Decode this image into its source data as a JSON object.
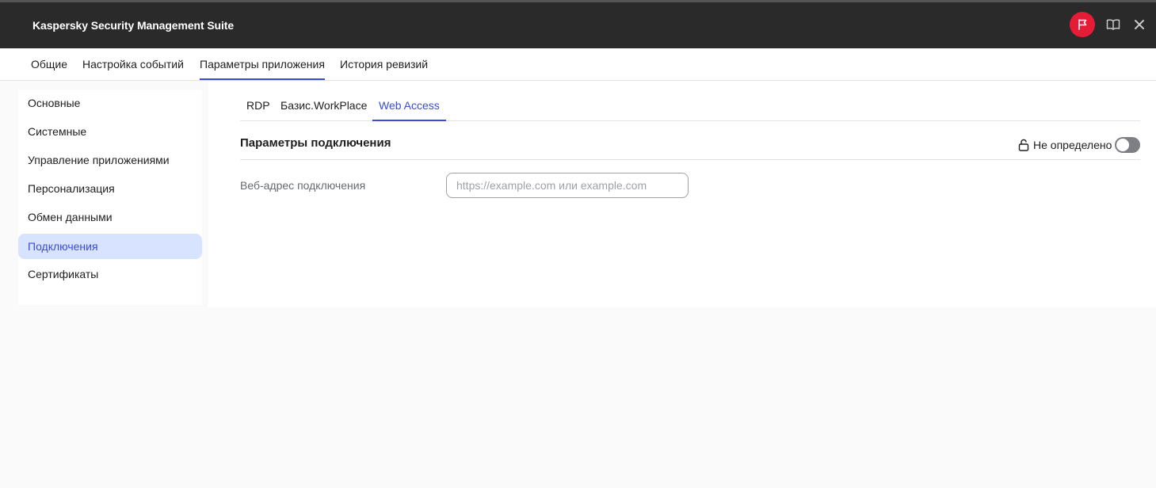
{
  "app": {
    "title": "Kaspersky Security Management Suite",
    "flag_icon": "flag-icon",
    "help_icon": "book-icon",
    "close_icon": "close-icon",
    "accent_color": "#e51c35"
  },
  "top_tabs": [
    {
      "label": "Общие",
      "active": false
    },
    {
      "label": "Настройка событий",
      "active": false
    },
    {
      "label": "Параметры приложения",
      "active": true
    },
    {
      "label": "История ревизий",
      "active": false
    }
  ],
  "sidebar": {
    "items": [
      {
        "label": "Основные",
        "active": false
      },
      {
        "label": "Системные",
        "active": false
      },
      {
        "label": "Управление приложениями",
        "active": false
      },
      {
        "label": "Персонализация",
        "active": false
      },
      {
        "label": "Обмен данными",
        "active": false
      },
      {
        "label": "Подключения",
        "active": true
      },
      {
        "label": "Сертификаты",
        "active": false
      }
    ]
  },
  "sub_tabs": [
    {
      "label": "RDP",
      "active": false
    },
    {
      "label": "Базис.WorkPlace",
      "active": false
    },
    {
      "label": "Web Access",
      "active": true
    }
  ],
  "section": {
    "title": "Параметры подключения",
    "lock_icon": "lock-open-icon",
    "lock_label": "Не определено",
    "toggle_on": false
  },
  "form": {
    "url_label": "Веб-адрес подключения",
    "url_value": "",
    "url_placeholder": "https://example.com или example.com"
  },
  "colors": {
    "active_blue": "#3a4bd8",
    "active_bg": "#d7e3ff",
    "titlebar_bg": "#2a2a2a"
  }
}
